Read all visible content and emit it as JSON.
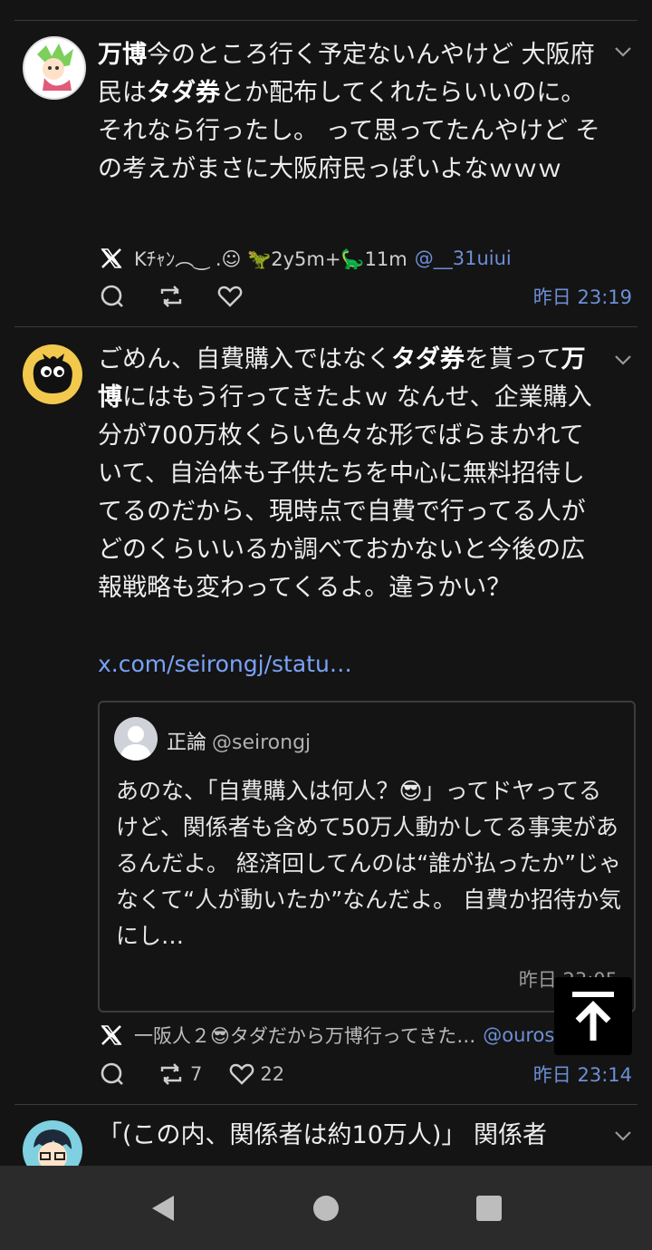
{
  "posts": [
    {
      "text_parts": [
        {
          "t": "万博",
          "b": true
        },
        {
          "t": "今のところ行く予定ないんやけど 大阪府民は",
          "b": false
        },
        {
          "t": "タダ券",
          "b": true
        },
        {
          "t": "とか配布してくれたらいいのに。 それなら行ったし。 って思ってたんやけど その考えがまさに大阪府民っぽいよなｗｗｗ",
          "b": false
        }
      ],
      "author": "Kﾁｬﾝ︵‿ .☺︎ 🦖2y5m+🦕11m",
      "handle": "@__31uiui",
      "time": "昨日 23:19"
    },
    {
      "text_parts": [
        {
          "t": "ごめん、自費購入ではなく",
          "b": false
        },
        {
          "t": "タダ券",
          "b": true
        },
        {
          "t": "を貰って",
          "b": false
        },
        {
          "t": "万博",
          "b": true
        },
        {
          "t": "にはもう行ってきたよｗ なんせ、企業購入分が700万枚くらい色々な形でばらまかれていて、自治体も子供たちを中心に無料招待してるのだから、現時点で自費で行ってる人がどのくらいいるか調べておかないと今後の広報戦略も変わってくるよ。違うかい？",
          "b": false
        }
      ],
      "link": "x.com/seirongj/statu…",
      "quote": {
        "name": "正論",
        "handle": "@seirongj",
        "text": "あのな、「自費購入は何人？😎」ってドヤってるけど、関係者も含めて50万人動かしてる事実があるんだよ。 経済回してんのは“誰が払ったか”じゃなくて“人が動いたか”なんだよ。 自費か招待か気にし…",
        "time": "昨日 23:05"
      },
      "author": "一阪人２😎タダだから万博行ってきた…",
      "handle": "@ourosa…",
      "retweets": "7",
      "likes": "22",
      "time": "昨日 23:14"
    },
    {
      "text": "「(この内、関係者は約10万人)」 関係者"
    }
  ]
}
